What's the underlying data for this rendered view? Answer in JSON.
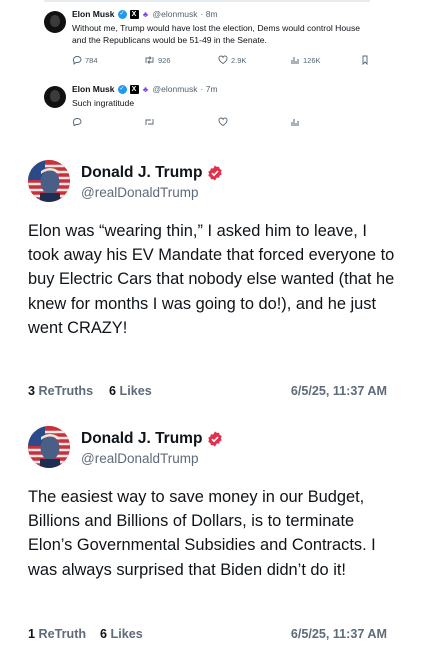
{
  "embed": {
    "tweets": [
      {
        "name": "Elon Musk",
        "handle": "@elonmusk",
        "time": "· 8m",
        "text": "Without me, Trump would have lost the election, Dems would control House and the Republicans would be 51-49 in the Senate.",
        "replies": "784",
        "reposts": "926",
        "likes": "2.9K",
        "views": "126K",
        "icons": {
          "reply": "reply-icon",
          "repost": "repost-icon",
          "like": "heart-icon",
          "views": "views-chart-icon",
          "bookmark": "bookmark-icon"
        }
      },
      {
        "name": "Elon Musk",
        "handle": "@elonmusk",
        "time": "· 7m",
        "text": "Such ingratitude"
      }
    ]
  },
  "posts": [
    {
      "display_name": "Donald J. Trump",
      "handle": "@realDonaldTrump",
      "text": "Elon was “wearing thin,” I asked him to leave, I took away his EV Mandate that forced everyone to buy Electric Cars that nobody else wanted (that he knew for months I was going to do!), and he just went CRAZY!",
      "retruths_count": "3",
      "retruths_label": "ReTruths",
      "likes_count": "6",
      "likes_label": "Likes",
      "timestamp": "6/5/25, 11:37 AM"
    },
    {
      "display_name": "Donald J. Trump",
      "handle": "@realDonaldTrump",
      "text": "The easiest way to save money in our Budget, Billions and Billions of Dollars, is to terminate Elon’s Governmental Subsidies and Contracts. I was always surprised that Biden didn’t do it!",
      "retruths_count": "1",
      "retruths_label": "ReTruth",
      "likes_count": "6",
      "likes_label": "Likes",
      "timestamp": "6/5/25, 11:37 AM"
    }
  ],
  "colors": {
    "verified_blue": "#1d9bf0",
    "truth_badge": "#e0304b",
    "muted_text": "#5f6b7a"
  }
}
